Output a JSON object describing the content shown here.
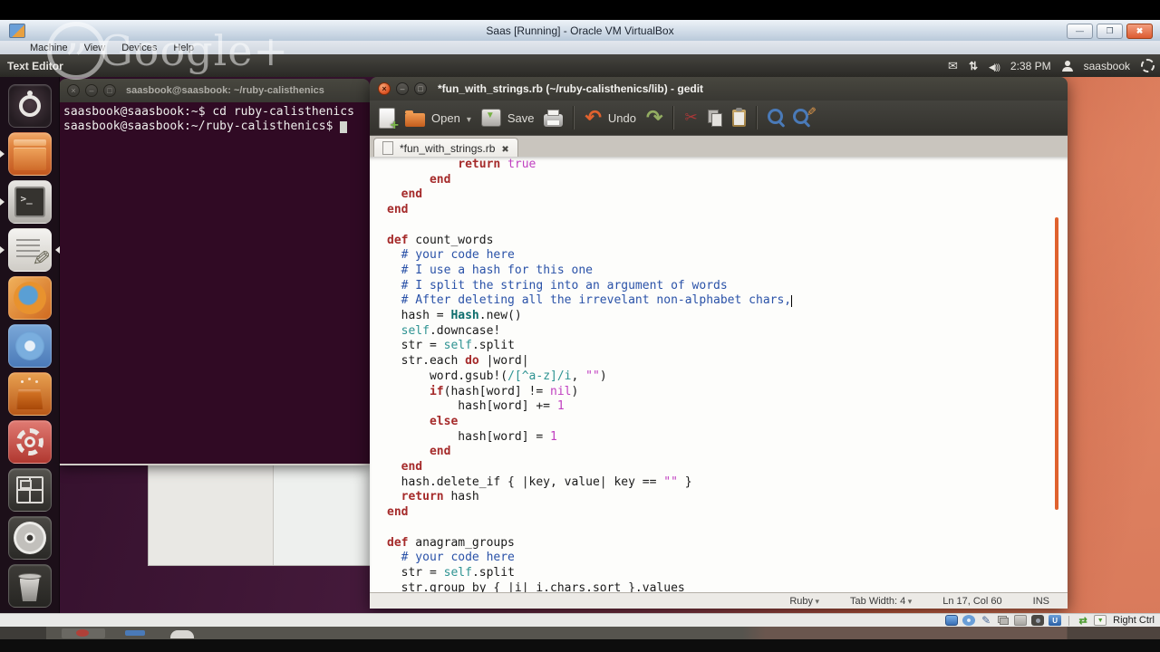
{
  "vbox": {
    "title": "Saas [Running] - Oracle VM VirtualBox",
    "menus": [
      "Machine",
      "View",
      "Devices",
      "Help"
    ],
    "window_buttons": [
      "minimize",
      "restore",
      "close"
    ],
    "status_icons": [
      "harddisk",
      "optical",
      "pen",
      "windows",
      "folder",
      "camera",
      "usb"
    ],
    "status_icons_right": [
      "network",
      "autoresize"
    ],
    "host_key": "Right Ctrl"
  },
  "panel": {
    "app_name": "Text Editor",
    "time": "2:38 PM",
    "user": "saasbook"
  },
  "watermark": {
    "text": "Google+"
  },
  "launcher": {
    "icons": [
      {
        "name": "dash",
        "running": false,
        "focused": false
      },
      {
        "name": "files",
        "running": true,
        "focused": false
      },
      {
        "name": "terminal",
        "running": true,
        "focused": false
      },
      {
        "name": "text-editor",
        "running": true,
        "focused": true
      },
      {
        "name": "firefox",
        "running": false,
        "focused": false
      },
      {
        "name": "chromium",
        "running": false,
        "focused": false
      },
      {
        "name": "software-center",
        "running": false,
        "focused": false
      },
      {
        "name": "settings",
        "running": false,
        "focused": false
      },
      {
        "name": "workspaces",
        "running": false,
        "focused": false
      },
      {
        "name": "cd-burner",
        "running": false,
        "focused": false
      },
      {
        "name": "trash",
        "running": false,
        "focused": false
      }
    ]
  },
  "terminal": {
    "title": "saasbook@saasbook: ~/ruby-calisthenics",
    "lines": [
      "saasbook@saasbook:~$ cd ruby-calisthenics",
      "saasbook@saasbook:~/ruby-calisthenics$ "
    ]
  },
  "gedit": {
    "title": "*fun_with_strings.rb (~/ruby-calisthenics/lib) - gedit",
    "toolbar": {
      "open_label": "Open",
      "save_label": "Save",
      "undo_label": "Undo",
      "icons": [
        "new-document",
        "open",
        "save",
        "print",
        "undo",
        "redo",
        "cut",
        "copy",
        "paste",
        "search",
        "search-replace"
      ]
    },
    "tab_label": "*fun_with_strings.rb",
    "status": {
      "language": "Ruby",
      "tab_width": "Tab Width: 4",
      "position": "Ln 17, Col 60",
      "mode": "INS"
    },
    "code": [
      [
        [
          "p",
          "          "
        ],
        [
          "k",
          "return"
        ],
        [
          "p",
          " "
        ],
        [
          "l",
          "true"
        ]
      ],
      [
        [
          "p",
          "      "
        ],
        [
          "k",
          "end"
        ]
      ],
      [
        [
          "p",
          "  "
        ],
        [
          "k",
          "end"
        ]
      ],
      [
        [
          "k",
          "end"
        ]
      ],
      [],
      [
        [
          "k",
          "def"
        ],
        [
          "p",
          " count_words"
        ]
      ],
      [
        [
          "p",
          "  "
        ],
        [
          "c",
          "# your code here"
        ]
      ],
      [
        [
          "p",
          "  "
        ],
        [
          "c",
          "# I use a hash for this one"
        ]
      ],
      [
        [
          "p",
          "  "
        ],
        [
          "c",
          "# I split the string into an argument of words"
        ]
      ],
      [
        [
          "p",
          "  "
        ],
        [
          "c",
          "# After deleting all the irrevelant non-alphabet chars,"
        ],
        [
          "cursor",
          ""
        ]
      ],
      [
        [
          "p",
          "  hash = "
        ],
        [
          "t",
          "Hash"
        ],
        [
          "p",
          ".new()"
        ]
      ],
      [
        [
          "p",
          "  "
        ],
        [
          "s",
          "self"
        ],
        [
          "p",
          ".downcase!"
        ]
      ],
      [
        [
          "p",
          "  str = "
        ],
        [
          "s",
          "self"
        ],
        [
          "p",
          ".split"
        ]
      ],
      [
        [
          "p",
          "  str.each "
        ],
        [
          "k",
          "do"
        ],
        [
          "p",
          " |word|"
        ]
      ],
      [
        [
          "p",
          "      word.gsub!("
        ],
        [
          "s",
          "/[^a-z]/i"
        ],
        [
          "p",
          ", "
        ],
        [
          "l",
          "\"\""
        ],
        [
          "p",
          ")"
        ]
      ],
      [
        [
          "p",
          "      "
        ],
        [
          "k",
          "if"
        ],
        [
          "p",
          "(hash[word] != "
        ],
        [
          "l",
          "nil"
        ],
        [
          "p",
          ")"
        ]
      ],
      [
        [
          "p",
          "          hash[word] += "
        ],
        [
          "l",
          "1"
        ]
      ],
      [
        [
          "p",
          "      "
        ],
        [
          "k",
          "else"
        ]
      ],
      [
        [
          "p",
          "          hash[word] = "
        ],
        [
          "l",
          "1"
        ]
      ],
      [
        [
          "p",
          "      "
        ],
        [
          "k",
          "end"
        ]
      ],
      [
        [
          "p",
          "  "
        ],
        [
          "k",
          "end"
        ]
      ],
      [
        [
          "p",
          "  hash.delete_if { |key, value| key == "
        ],
        [
          "l",
          "\"\""
        ],
        [
          "p",
          " }"
        ]
      ],
      [
        [
          "p",
          "  "
        ],
        [
          "k",
          "return"
        ],
        [
          "p",
          " hash"
        ]
      ],
      [
        [
          "k",
          "end"
        ]
      ],
      [],
      [
        [
          "k",
          "def"
        ],
        [
          "p",
          " anagram_groups"
        ]
      ],
      [
        [
          "p",
          "  "
        ],
        [
          "c",
          "# your code here"
        ]
      ],
      [
        [
          "p",
          "  str = "
        ],
        [
          "s",
          "self"
        ],
        [
          "p",
          ".split"
        ]
      ],
      [
        [
          "p",
          "  str.group_by { |i| i.chars.sort }.values"
        ]
      ]
    ]
  },
  "colors": {
    "ubuntu_orange": "#dd4814",
    "terminal_bg": "#300a24",
    "keyword": "#a52a2a",
    "comment": "#2a52a8",
    "literal": "#c03fc0",
    "builtin": "#2e9392",
    "scrollbar": "#e0622e"
  }
}
